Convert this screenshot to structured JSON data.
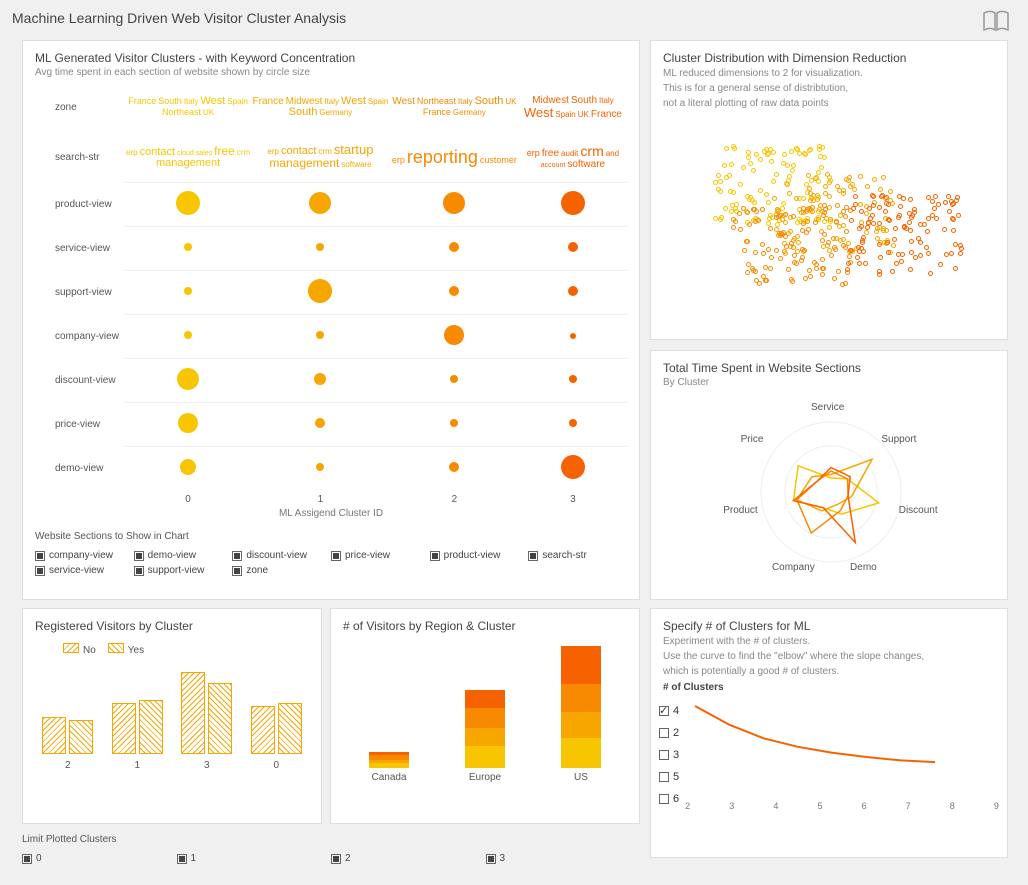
{
  "page_title": "Machine Learning Driven Web Visitor Cluster Analysis",
  "icon_name": "book-icon",
  "colors": {
    "c0": "#f7c600",
    "c1": "#f7a600",
    "c2": "#f78a00",
    "c3": "#f76200"
  },
  "bubble_panel": {
    "title": "ML Generated Visitor Clusters - with Keyword Concentration",
    "subtitle": "Avg time spent in each section of website shown by circle size",
    "x_axis_label": "ML Assigend Cluster ID",
    "filter_label": "Website Sections to Show in Chart",
    "filters": [
      "company-view",
      "demo-view",
      "discount-view",
      "price-view",
      "product-view",
      "search-str",
      "service-view",
      "support-view",
      "zone"
    ],
    "row_labels": [
      "zone",
      "search-str",
      "product-view",
      "service-view",
      "support-view",
      "company-view",
      "discount-view",
      "price-view",
      "demo-view"
    ],
    "cluster_ids": [
      "0",
      "1",
      "2",
      "3"
    ],
    "keywords": {
      "zone": [
        [
          {
            "t": "France",
            "s": 9
          },
          {
            "t": "South",
            "s": 9
          },
          {
            "t": "Italy",
            "s": 8
          },
          {
            "t": "West",
            "s": 11
          },
          {
            "t": "Spain",
            "s": 8
          },
          {
            "t": "Northeast",
            "s": 9
          },
          {
            "t": "UK",
            "s": 8
          }
        ],
        [
          {
            "t": "France",
            "s": 10
          },
          {
            "t": "Midwest",
            "s": 10
          },
          {
            "t": "Italy",
            "s": 8
          },
          {
            "t": "West",
            "s": 11
          },
          {
            "t": "Spain",
            "s": 8
          },
          {
            "t": "South",
            "s": 11
          },
          {
            "t": "Germany",
            "s": 8
          }
        ],
        [
          {
            "t": "West",
            "s": 10
          },
          {
            "t": "Northeast",
            "s": 9
          },
          {
            "t": "Italy",
            "s": 8
          },
          {
            "t": "South",
            "s": 11
          },
          {
            "t": "UK",
            "s": 8
          },
          {
            "t": "France",
            "s": 9
          },
          {
            "t": "Germany",
            "s": 8
          }
        ],
        [
          {
            "t": "Midwest",
            "s": 10
          },
          {
            "t": "South",
            "s": 10
          },
          {
            "t": "Italy",
            "s": 8
          },
          {
            "t": "West",
            "s": 13
          },
          {
            "t": "Spain",
            "s": 8
          },
          {
            "t": "UK",
            "s": 8
          },
          {
            "t": "France",
            "s": 10
          }
        ]
      ],
      "search": [
        [
          {
            "t": "erp",
            "s": 8
          },
          {
            "t": "contact",
            "s": 11
          },
          {
            "t": "cloud",
            "s": 7
          },
          {
            "t": "sales",
            "s": 7
          },
          {
            "t": "free",
            "s": 12
          },
          {
            "t": "crm",
            "s": 8
          },
          {
            "t": "management",
            "s": 11
          }
        ],
        [
          {
            "t": "erp",
            "s": 8
          },
          {
            "t": "contact",
            "s": 11
          },
          {
            "t": "crm",
            "s": 8
          },
          {
            "t": "startup",
            "s": 13
          },
          {
            "t": "management",
            "s": 12
          },
          {
            "t": "software",
            "s": 8
          }
        ],
        [
          {
            "t": "erp",
            "s": 9
          },
          {
            "t": "reporting",
            "s": 18
          },
          {
            "t": "customer",
            "s": 9
          }
        ],
        [
          {
            "t": "erp",
            "s": 9
          },
          {
            "t": "free",
            "s": 10
          },
          {
            "t": "audit",
            "s": 8
          },
          {
            "t": "crm",
            "s": 14
          },
          {
            "t": "and",
            "s": 8
          },
          {
            "t": "account",
            "s": 7
          },
          {
            "t": "software",
            "s": 10
          }
        ]
      ]
    }
  },
  "chart_data": [
    {
      "name": "bubble_matrix",
      "type": "scatter",
      "title": "ML Generated Visitor Clusters - with Keyword Concentration",
      "xlabel": "ML Assigend Cluster ID",
      "categories_x": [
        "0",
        "1",
        "2",
        "3"
      ],
      "categories_y": [
        "product-view",
        "service-view",
        "support-view",
        "company-view",
        "discount-view",
        "price-view",
        "demo-view"
      ],
      "series": [
        {
          "name": "0",
          "color": "#f7c600",
          "sizes": [
            24,
            8,
            8,
            8,
            22,
            20,
            16
          ]
        },
        {
          "name": "1",
          "color": "#f7a600",
          "sizes": [
            22,
            8,
            24,
            8,
            12,
            10,
            8
          ]
        },
        {
          "name": "2",
          "color": "#f78a00",
          "sizes": [
            22,
            10,
            10,
            20,
            8,
            8,
            10
          ]
        },
        {
          "name": "3",
          "color": "#f76200",
          "sizes": [
            24,
            10,
            10,
            6,
            8,
            8,
            24
          ]
        }
      ]
    },
    {
      "name": "registered_visitors",
      "type": "bar",
      "title": "Registered Visitors by Cluster",
      "categories": [
        "2",
        "1",
        "3",
        "0"
      ],
      "series": [
        {
          "name": "No",
          "values": [
            22,
            30,
            48,
            28
          ]
        },
        {
          "name": "Yes",
          "values": [
            20,
            32,
            42,
            30
          ]
        }
      ],
      "legend": [
        "No",
        "Yes"
      ]
    },
    {
      "name": "visitors_by_region",
      "type": "bar",
      "title": "# of Visitors by Region & Cluster",
      "categories": [
        "Canada",
        "Europe",
        "US"
      ],
      "series": [
        {
          "name": "0",
          "color": "#f7c600",
          "values": [
            5,
            22,
            30
          ]
        },
        {
          "name": "1",
          "color": "#f7a600",
          "values": [
            3,
            18,
            26
          ]
        },
        {
          "name": "2",
          "color": "#f78a00",
          "values": [
            5,
            20,
            28
          ]
        },
        {
          "name": "3",
          "color": "#f76200",
          "values": [
            3,
            18,
            38
          ]
        }
      ]
    },
    {
      "name": "cluster_scatter",
      "type": "scatter",
      "title": "Cluster Distribution with Dimension Reduction",
      "note": [
        "ML reduced dimensions to 2 for visualization.",
        "This is for a general sense of distribtution,",
        "not a literal plotting of raw data points"
      ],
      "clusters": [
        "0",
        "1",
        "2",
        "3"
      ],
      "colors": [
        "#f7c600",
        "#f7a600",
        "#f78a00",
        "#f76200"
      ]
    },
    {
      "name": "time_spent_radar",
      "type": "area",
      "title": "Total Time Spent in Website Sections",
      "subtitle": "By Cluster",
      "axes": [
        "Service",
        "Support",
        "Discount",
        "Demo",
        "Company",
        "Product",
        "Price"
      ],
      "series": [
        {
          "name": "0",
          "color": "#f7c600",
          "values": [
            20,
            30,
            70,
            35,
            25,
            55,
            60
          ]
        },
        {
          "name": "1",
          "color": "#f7a600",
          "values": [
            25,
            75,
            30,
            20,
            30,
            50,
            35
          ]
        },
        {
          "name": "2",
          "color": "#f78a00",
          "values": [
            30,
            30,
            25,
            30,
            65,
            50,
            25
          ]
        },
        {
          "name": "3",
          "color": "#f76200",
          "values": [
            35,
            35,
            25,
            80,
            25,
            55,
            25
          ]
        }
      ]
    },
    {
      "name": "elbow",
      "type": "line",
      "title": "Specify # of Clusters for ML",
      "note": [
        "Experiment with the # of clusters.",
        "Use the curve to find the \"elbow\" where the slope changes,",
        "which is potentially a good # of clusters."
      ],
      "control_label": "# of Clusters",
      "options": [
        "4",
        "2",
        "3",
        "5",
        "6"
      ],
      "selected": "4",
      "x": [
        2,
        3,
        4,
        5,
        6,
        7,
        8,
        9
      ],
      "values": [
        100,
        78,
        62,
        52,
        45,
        40,
        36,
        34
      ]
    }
  ],
  "limit_panel": {
    "label": "Limit Plotted Clusters",
    "options": [
      "0",
      "1",
      "2",
      "3"
    ]
  }
}
